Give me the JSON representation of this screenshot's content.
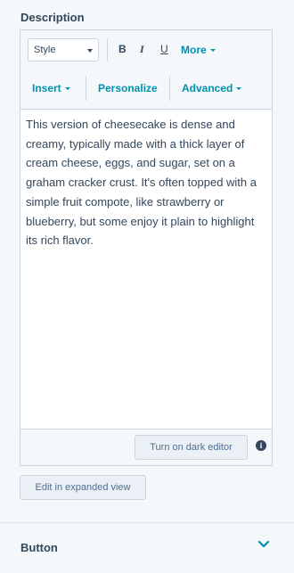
{
  "description_section": {
    "title": "Description"
  },
  "toolbar": {
    "style_select": "Style",
    "bold": "B",
    "italic": "I",
    "underline": "U",
    "more": "More",
    "insert": "Insert",
    "personalize": "Personalize",
    "advanced": "Advanced"
  },
  "editor": {
    "content": "This version of cheesecake is dense and creamy, typically made with a thick layer of cream cheese, eggs, and sugar, set on a graham cracker crust. It's often topped with a simple fruit compote, like strawberry or blueberry, but some enjoy it plain to highlight its rich flavor."
  },
  "footer": {
    "dark_editor_button": "Turn on dark editor",
    "info_icon": "info-icon"
  },
  "expand_button": "Edit in expanded view",
  "button_section": {
    "title": "Button",
    "chevron_icon": "chevron-down-icon"
  },
  "colors": {
    "text": "#33475b",
    "link": "#0091ae",
    "border": "#cbd6e2",
    "panel_bg": "#f5f8fa"
  }
}
